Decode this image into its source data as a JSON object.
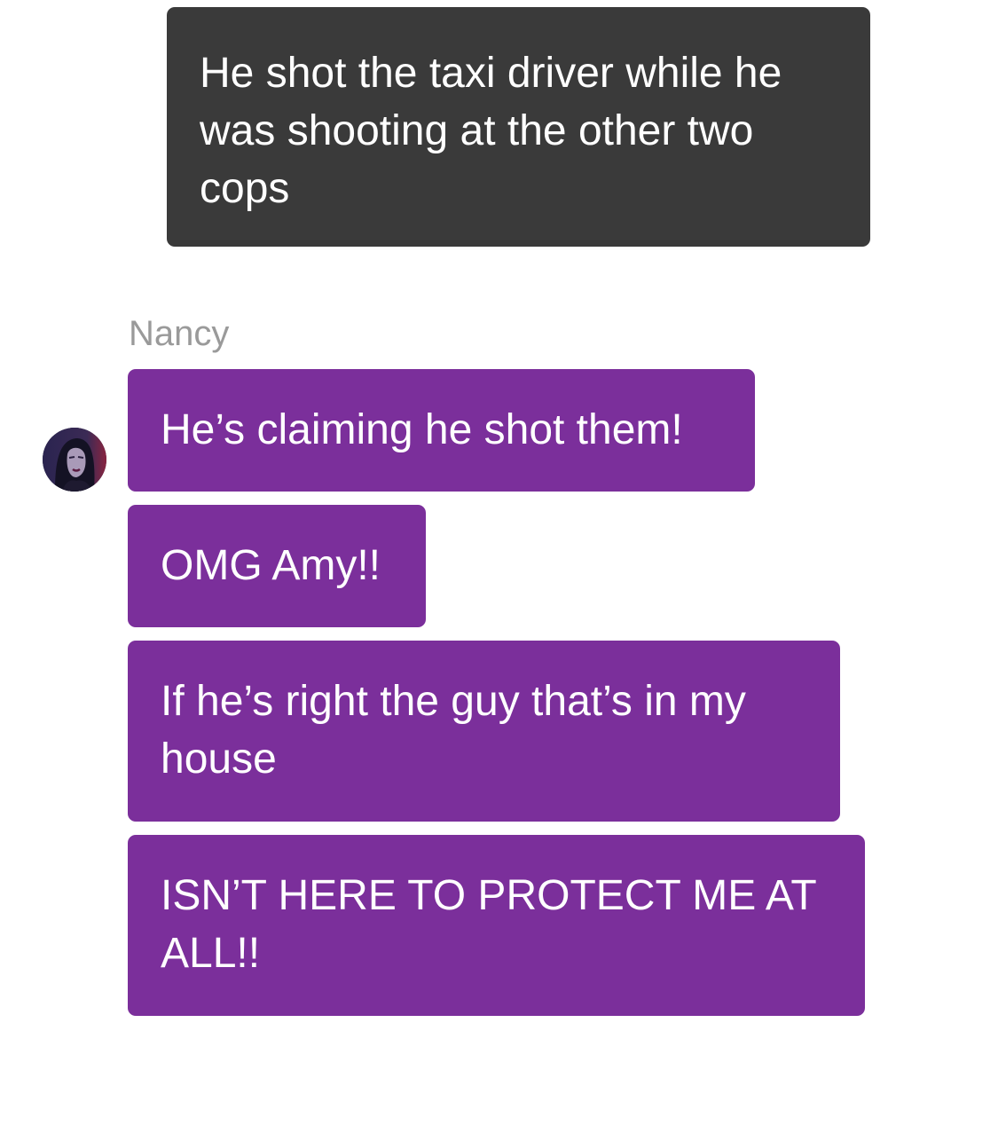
{
  "conversation": {
    "narrator_message": "He shot the taxi driver while he was shooting at the other two cops",
    "sender": {
      "name": "Nancy",
      "avatar_icon": "character-portrait-icon"
    },
    "messages": [
      {
        "text": "He’s claiming he shot them!"
      },
      {
        "text": "OMG Amy!!"
      },
      {
        "text": "If he’s right the guy that’s in my house"
      },
      {
        "text": "ISN’T HERE TO PROTECT ME AT ALL!!"
      }
    ]
  },
  "colors": {
    "narrator_bubble": "#3a3a3a",
    "sender_bubble": "#7b2f9b",
    "bubble_text": "#ffffff",
    "sender_name": "#9a9a9a",
    "background": "#ffffff"
  }
}
